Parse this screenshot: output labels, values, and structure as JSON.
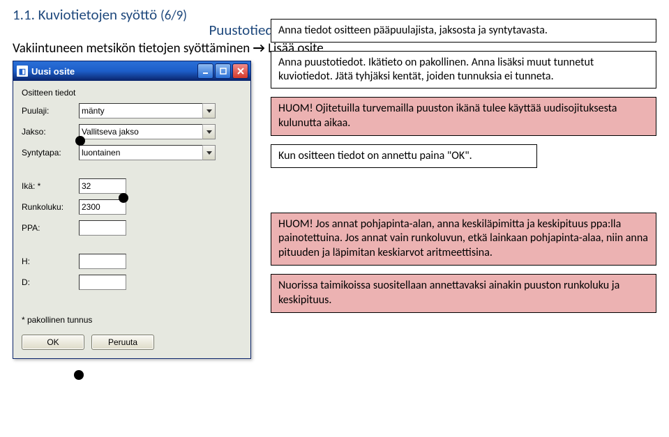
{
  "heading": {
    "number": "1.1.",
    "title": "Kuviotietojen syöttö",
    "step": "(6/9)",
    "section": "Puustotiedot",
    "intro_pre": "Vakiintuneen metsikön tietojen syöttäminen",
    "intro_arrow": "→",
    "intro_post": "Lisää osite"
  },
  "dialog": {
    "title": "Uusi osite",
    "group_label": "Ositteen tiedot",
    "rows": {
      "puulaji_label": "Puulaji:",
      "puulaji_value": "mänty",
      "jakso_label": "Jakso:",
      "jakso_value": "Vallitseva jakso",
      "syntytapa_label": "Syntytapa:",
      "syntytapa_value": "luontainen",
      "ika_label": "Ikä: *",
      "ika_value": "32",
      "runkoluku_label": "Runkoluku:",
      "runkoluku_value": "2300",
      "ppa_label": "PPA:",
      "ppa_value": "",
      "h_label": "H:",
      "h_value": "",
      "d_label": "D:",
      "d_value": ""
    },
    "footnote": "* pakollinen tunnus",
    "ok": "OK",
    "cancel": "Peruuta"
  },
  "callouts": {
    "c1": "Anna tiedot ositteen pääpuulajista, jaksosta ja syntytavasta.",
    "c2": "Anna puustotiedot. Ikätieto on pakollinen. Anna lisäksi muut tunnetut kuviotiedot. Jätä tyhjäksi kentät, joiden tunnuksia ei tunneta.",
    "c3": "HUOM! Ojitetuilla turvemailla puuston ikänä tulee käyttää uudisojituksesta kulunutta aikaa.",
    "c4": "Kun ositteen tiedot on annettu paina \"OK\".",
    "c5": "HUOM! Jos annat pohjapinta-alan, anna keskiläpimitta ja keskipituus ppa:lla painotettuina. Jos annat vain runkoluvun, etkä lainkaan pohjapinta-alaa, niin anna pituuden ja läpimitan keskiarvot aritmeettisina.",
    "c6": "Nuorissa taimikoissa suositellaan annettavaksi ainakin puuston runkoluku ja keskipituus."
  }
}
